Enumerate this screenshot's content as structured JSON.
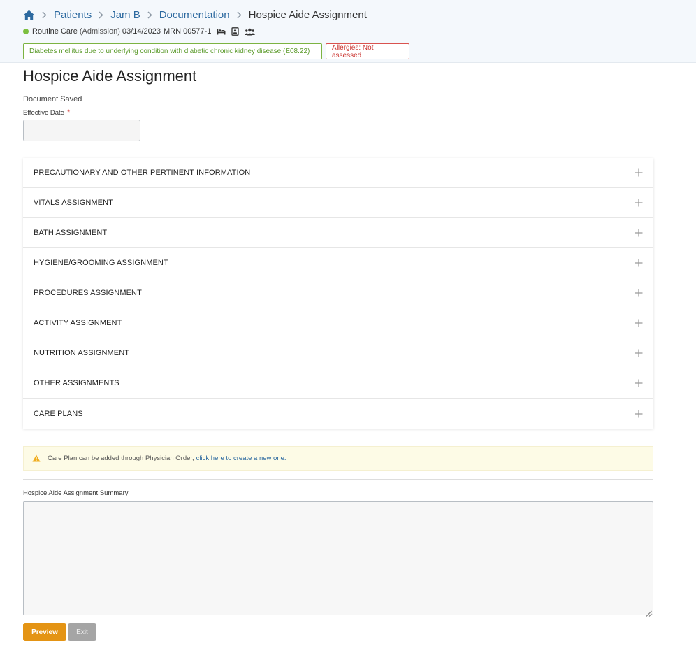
{
  "breadcrumb": {
    "items": [
      "Patients",
      "Jam B",
      "Documentation"
    ],
    "current": "Hospice Aide Assignment"
  },
  "patient": {
    "care_level": "Routine Care",
    "status": "(Admission)",
    "date": "03/14/2023",
    "mrn": "MRN 00577-1"
  },
  "badges": {
    "diagnosis": "Diabetes mellitus due to underlying condition with diabetic chronic kidney disease (E08.22)",
    "allergies": "Allergies: Not assessed"
  },
  "page": {
    "title": "Hospice Aide Assignment",
    "saved": "Document Saved",
    "effective_label": "Effective Date",
    "required_mark": "*",
    "effective_value": ""
  },
  "sections": [
    "PRECAUTIONARY AND OTHER PERTINENT INFORMATION",
    "VITALS ASSIGNMENT",
    "BATH ASSIGNMENT",
    "HYGIENE/GROOMING ASSIGNMENT",
    "PROCEDURES ASSIGNMENT",
    "ACTIVITY ASSIGNMENT",
    "NUTRITION ASSIGNMENT",
    "OTHER ASSIGNMENTS",
    "CARE PLANS"
  ],
  "alert": {
    "text": "Care Plan can be added through Physician Order,",
    "link": "click here to create a new one."
  },
  "summary": {
    "label": "Hospice Aide Assignment Summary",
    "value": ""
  },
  "buttons": {
    "preview": "Preview",
    "exit": "Exit"
  },
  "colors": {
    "link": "#2d6aa0",
    "diagnosis_badge": "#7cb342",
    "allergy_badge": "#d9534f",
    "preview_button": "#e49414",
    "exit_button": "#a5a5a5",
    "status_dot": "#7cbf3f"
  }
}
